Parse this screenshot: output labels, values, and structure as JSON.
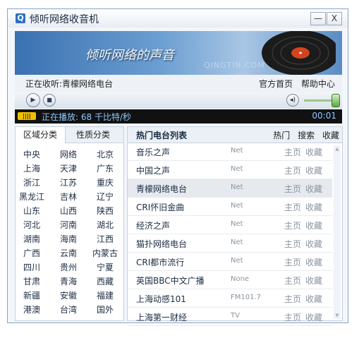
{
  "window": {
    "title": "倾听网络收音机",
    "minimize": "—",
    "close": "X"
  },
  "banner": {
    "slogan": "倾听网络的声音",
    "sub": "QINGTIN.COM"
  },
  "listening": {
    "text": "正在收听:青檬网络电台",
    "links": [
      "官方首页",
      "帮助中心"
    ]
  },
  "status": {
    "playing": "正在播放: 68 千比特/秒",
    "time": "00:01"
  },
  "tabs": [
    "区域分类",
    "性质分类"
  ],
  "regions": [
    [
      "中央",
      "网络",
      "北京"
    ],
    [
      "上海",
      "天津",
      "广东"
    ],
    [
      "浙江",
      "江苏",
      "重庆"
    ],
    [
      "黑龙江",
      "吉林",
      "辽宁"
    ],
    [
      "山东",
      "山西",
      "陕西"
    ],
    [
      "河北",
      "河南",
      "湖北"
    ],
    [
      "湖南",
      "海南",
      "江西"
    ],
    [
      "广西",
      "云南",
      "内蒙古"
    ],
    [
      "四川",
      "贵州",
      "宁夏"
    ],
    [
      "甘肃",
      "青海",
      "西藏"
    ],
    [
      "新疆",
      "安徽",
      "福建"
    ],
    [
      "港澳",
      "台湾",
      "国外"
    ]
  ],
  "list_header": {
    "title": "热门电台列表",
    "links": [
      "热门",
      "搜索",
      "收藏"
    ]
  },
  "stations": [
    {
      "name": "音乐之声",
      "rate": "Net",
      "home": "主页",
      "fav": "收藏"
    },
    {
      "name": "中国之声",
      "rate": "Net",
      "home": "主页",
      "fav": "收藏"
    },
    {
      "name": "青檬网络电台",
      "rate": "Net",
      "home": "主页",
      "fav": "收藏"
    },
    {
      "name": "CRI怀旧金曲",
      "rate": "Net",
      "home": "主页",
      "fav": "收藏"
    },
    {
      "name": "经济之声",
      "rate": "Net",
      "home": "主页",
      "fav": "收藏"
    },
    {
      "name": "猫扑网络电台",
      "rate": "Net",
      "home": "主页",
      "fav": "收藏"
    },
    {
      "name": "CRI都市流行",
      "rate": "Net",
      "home": "主页",
      "fav": "收藏"
    },
    {
      "name": "英国BBC中文广播",
      "rate": "None",
      "home": "主页",
      "fav": "收藏"
    },
    {
      "name": "上海动感101",
      "rate": "FM101.7",
      "home": "主页",
      "fav": "收藏"
    },
    {
      "name": "上海第一财经",
      "rate": "TV",
      "home": "主页",
      "fav": "收藏"
    }
  ],
  "selected_index": 2,
  "colors": {
    "accent": "#2d6fc0",
    "status_bg": "#111111",
    "status_text": "#8fc6ff"
  }
}
